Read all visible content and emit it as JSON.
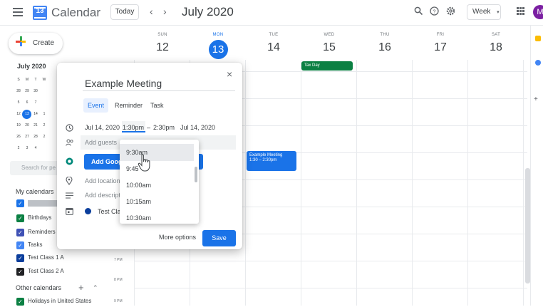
{
  "header": {
    "app_title": "Calendar",
    "logo_day": "13",
    "today_label": "Today",
    "prev_label": "‹",
    "next_label": "›",
    "month_title": "July 2020",
    "icons": [
      "search-icon",
      "help-icon",
      "settings-icon"
    ],
    "view_label": "Week",
    "avatar_letter": "M"
  },
  "sidebar": {
    "create_label": "Create",
    "mini_month": "July 2020",
    "mini_dow": [
      "S",
      "M",
      "T",
      "W"
    ],
    "mini_weeks": [
      [
        "28",
        "29",
        "30",
        ""
      ],
      [
        "5",
        "6",
        "7",
        ""
      ],
      [
        "12",
        "13",
        "14",
        "1"
      ],
      [
        "19",
        "20",
        "21",
        "2"
      ],
      [
        "26",
        "27",
        "28",
        "2"
      ],
      [
        "2",
        "3",
        "4",
        ""
      ]
    ],
    "search_placeholder": "Search for pe",
    "my_calendars_title": "My calendars",
    "my_calendars": [
      {
        "label": "",
        "color": "#1a73e8"
      },
      {
        "label": "Birthdays",
        "color": "#0b8043"
      },
      {
        "label": "Reminders",
        "color": "#3f51b5"
      },
      {
        "label": "Tasks",
        "color": "#4285f4"
      },
      {
        "label": "Test Class 1 A",
        "color": "#0b3e9c"
      },
      {
        "label": "Test Class 2 A",
        "color": "#202124"
      }
    ],
    "other_calendars_title": "Other calendars",
    "other_calendars": [
      {
        "label": "Holidays in United States",
        "color": "#0b8043"
      }
    ]
  },
  "week": {
    "days": [
      {
        "dow": "SUN",
        "num": "12"
      },
      {
        "dow": "MON",
        "num": "13",
        "today": true
      },
      {
        "dow": "TUE",
        "num": "14"
      },
      {
        "dow": "WED",
        "num": "15"
      },
      {
        "dow": "THU",
        "num": "16"
      },
      {
        "dow": "FRI",
        "num": "17"
      },
      {
        "dow": "SAT",
        "num": "18"
      }
    ],
    "time_labels": [
      "7 PM",
      "8 PM",
      "9 PM"
    ],
    "all_day_event": {
      "label": "Tax Day",
      "color": "#0b8043"
    },
    "event": {
      "title": "Example Meeting",
      "time": "1:30 – 2:30pm",
      "color": "#1a73e8"
    }
  },
  "dialog": {
    "title": "Example Meeting",
    "tabs": [
      "Event",
      "Reminder",
      "Task"
    ],
    "start_date": "Jul 14, 2020",
    "start_time": "1:30pm",
    "dash": "–",
    "end_time": "2:30pm",
    "end_date": "Jul 14, 2020",
    "guests_placeholder": "Add guests",
    "meet_button": "Add Goog",
    "location_placeholder": "Add location",
    "description_placeholder": "Add descripti",
    "calendar_label": "Test Cla",
    "more_options": "More options",
    "save": "Save",
    "close": "×"
  },
  "time_dropdown": {
    "options": [
      "9:30am",
      "9:45",
      "10:00am",
      "10:15am",
      "10:30am"
    ],
    "hovered": "9:30am"
  },
  "colors": {
    "accent": "#1a73e8",
    "tax_day": "#0b8043"
  }
}
